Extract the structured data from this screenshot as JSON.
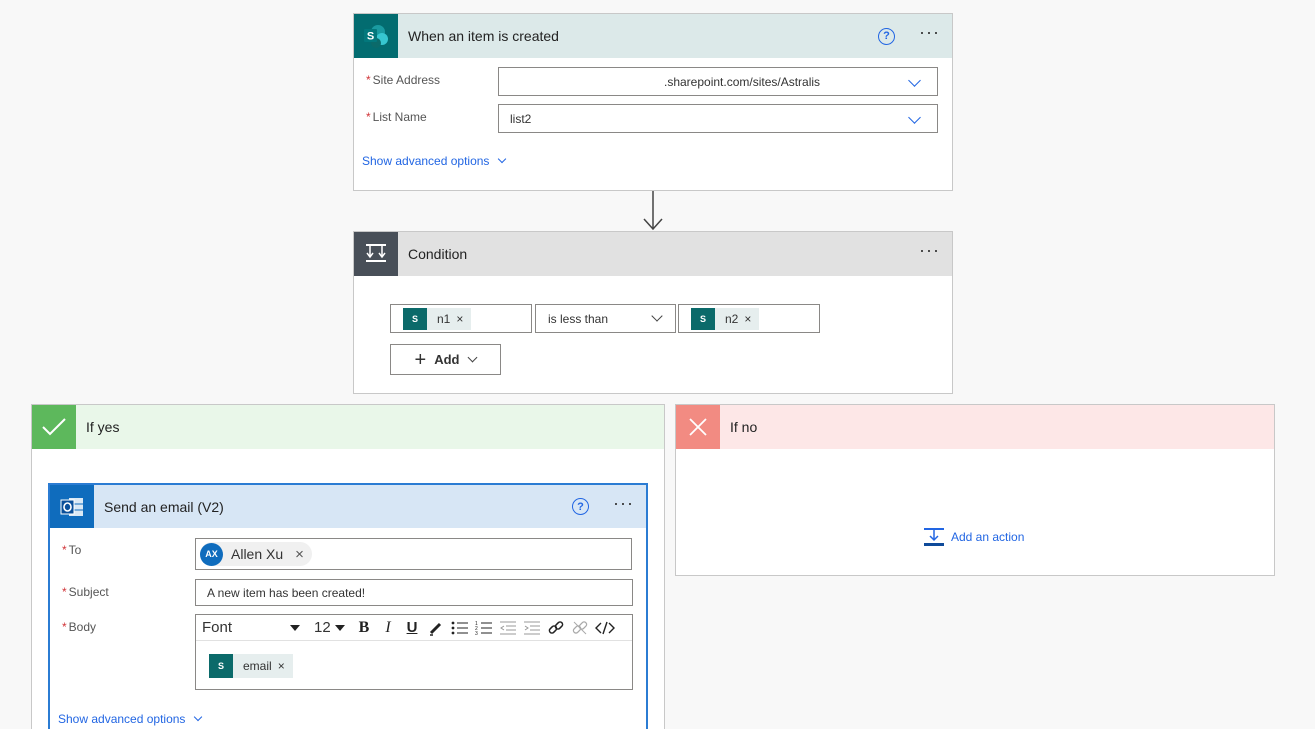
{
  "trigger": {
    "title": "When an item is created",
    "help_glyph": "?",
    "more_glyph": "···",
    "icon": "sharepoint-icon",
    "fields": {
      "site_address_label": "Site Address",
      "site_address_value": ".sharepoint.com/sites/Astralis",
      "list_name_label": "List Name",
      "list_name_value": "list2"
    },
    "advanced": "Show advanced options"
  },
  "condition": {
    "title": "Condition",
    "more_glyph": "···",
    "left_token": "n1",
    "operator": "is less than",
    "right_token": "n2",
    "token_close": "×",
    "add_label": "Add"
  },
  "if_yes": {
    "title": "If yes",
    "accent": "#5db85c"
  },
  "if_no": {
    "title": "If no",
    "accent": "#f28b82",
    "add_action": "Add an action"
  },
  "email": {
    "title": "Send an email (V2)",
    "help_glyph": "?",
    "more_glyph": "···",
    "to_label": "To",
    "recipient_initials": "AX",
    "recipient_name": "Allen Xu",
    "recipient_close": "×",
    "subject_label": "Subject",
    "subject_value": "A new item has been created!",
    "body_label": "Body",
    "font_select": "Font",
    "size_select": "12",
    "body_token": "email",
    "advanced": "Show advanced options"
  },
  "colors": {
    "sharepoint": "#036c70",
    "link": "#2266e3",
    "trigger_header": "#dce9e9",
    "condition_header": "#e1e1e1",
    "yes_header": "#e9f7e9",
    "no_header": "#fde7e7",
    "email_header": "#d7e6f5",
    "outlook": "#0f6cbd"
  }
}
